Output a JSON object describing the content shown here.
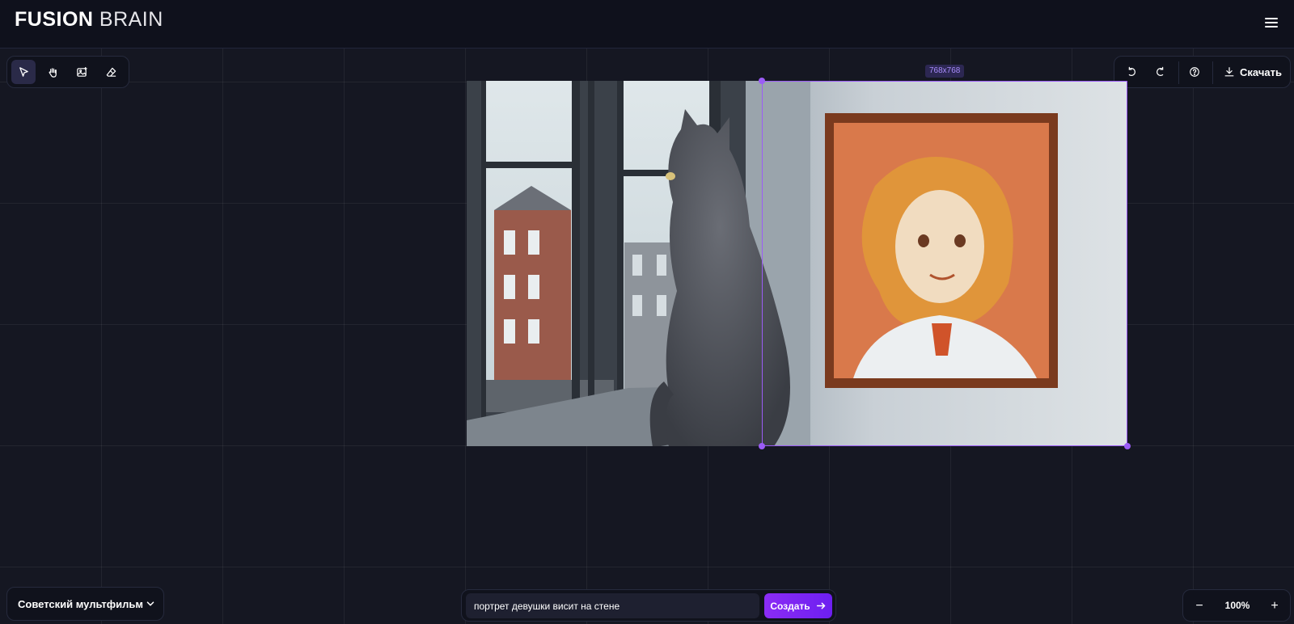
{
  "header": {
    "logo_bold": "FUSION",
    "logo_light": "BRAIN",
    "menu_icon": "hamburger-menu-icon"
  },
  "tools": [
    {
      "name": "select",
      "icon": "cursor-icon",
      "active": true
    },
    {
      "name": "hand",
      "icon": "hand-icon",
      "active": false
    },
    {
      "name": "image",
      "icon": "image-plus-icon",
      "active": false
    },
    {
      "name": "eraser",
      "icon": "eraser-icon",
      "active": false
    }
  ],
  "actions": {
    "undo_icon": "undo-icon",
    "redo_icon": "redo-icon",
    "help_icon": "help-icon",
    "download_label": "Скачать"
  },
  "canvas": {
    "selection_size": "768x768"
  },
  "bottom": {
    "style_label": "Советский мультфильм",
    "prompt_value": "портрет девушки висит на стене",
    "create_label": "Создать",
    "zoom_value": "100%",
    "zoom_out": "−",
    "zoom_in": "+"
  },
  "colors": {
    "accent": "#9b5cf6",
    "background": "#151722",
    "panel": "#10121c"
  }
}
